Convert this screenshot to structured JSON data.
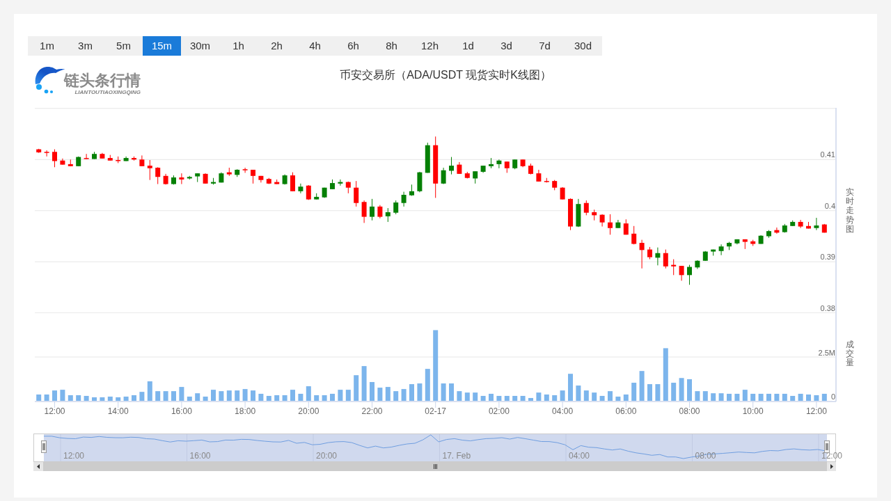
{
  "timeframes": [
    {
      "label": "1m",
      "selected": false
    },
    {
      "label": "3m",
      "selected": false
    },
    {
      "label": "5m",
      "selected": false
    },
    {
      "label": "15m",
      "selected": true
    },
    {
      "label": "30m",
      "selected": false
    },
    {
      "label": "1h",
      "selected": false
    },
    {
      "label": "2h",
      "selected": false
    },
    {
      "label": "4h",
      "selected": false
    },
    {
      "label": "6h",
      "selected": false
    },
    {
      "label": "8h",
      "selected": false
    },
    {
      "label": "12h",
      "selected": false
    },
    {
      "label": "1d",
      "selected": false
    },
    {
      "label": "3d",
      "selected": false
    },
    {
      "label": "7d",
      "selected": false
    },
    {
      "label": "30d",
      "selected": false
    }
  ],
  "logo": {
    "name": "链头条行情",
    "subtitle": "LIANTOUTIAOXINGQING"
  },
  "title": "币安交易所（ADA/USDT 现货实时K线图）",
  "price_chart": {
    "chart_data": {
      "type": "candlestick",
      "ylabel": "实时走势图",
      "grid": true,
      "categories": [
        null,
        null,
        null,
        null,
        null,
        null,
        null,
        null,
        null,
        null,
        null,
        null,
        null,
        null,
        null,
        null,
        null,
        null,
        null,
        null,
        null,
        null,
        null,
        null,
        null,
        null,
        null,
        null,
        null,
        null,
        null,
        null,
        null,
        null,
        null,
        null,
        null,
        null,
        null,
        null,
        null,
        null,
        null,
        null,
        null,
        null,
        null,
        null,
        null,
        null,
        null,
        null,
        null,
        null,
        null,
        null,
        null,
        null,
        null,
        null,
        null,
        null,
        null,
        null,
        null,
        null,
        null,
        null,
        null,
        null,
        null,
        null,
        null,
        null,
        null,
        null,
        null,
        null,
        null,
        null,
        null,
        null,
        null,
        null,
        null,
        null,
        null,
        null,
        null,
        null,
        null,
        null,
        null,
        null,
        null,
        null,
        null,
        null,
        null,
        null
      ],
      "ylim": [
        0.38,
        0.42
      ],
      "yticks": [
        0.41,
        0.4,
        0.39,
        0.38
      ],
      "ohlc": [
        [
          0.412,
          0.4121,
          0.4113,
          0.4114
        ],
        [
          0.4115,
          0.4118,
          0.4106,
          0.4114
        ],
        [
          0.4115,
          0.412,
          0.4085,
          0.4097
        ],
        [
          0.4098,
          0.4102,
          0.409,
          0.409
        ],
        [
          0.4091,
          0.41,
          0.4087,
          0.4087
        ],
        [
          0.4087,
          0.4106,
          0.4087,
          0.4105
        ],
        [
          0.4103,
          0.4111,
          0.4101,
          0.4101
        ],
        [
          0.4101,
          0.4115,
          0.4101,
          0.4111
        ],
        [
          0.4111,
          0.4113,
          0.4102,
          0.4102
        ],
        [
          0.4103,
          0.4109,
          0.4098,
          0.4098
        ],
        [
          0.4099,
          0.4106,
          0.4093,
          0.4097
        ],
        [
          0.4097,
          0.4106,
          0.4097,
          0.4103
        ],
        [
          0.4103,
          0.4106,
          0.4098,
          0.41
        ],
        [
          0.41,
          0.4108,
          0.4087,
          0.4087
        ],
        [
          0.4088,
          0.4099,
          0.406,
          0.4083
        ],
        [
          0.4084,
          0.4085,
          0.4052,
          0.4066
        ],
        [
          0.4068,
          0.4072,
          0.4051,
          0.4052
        ],
        [
          0.4052,
          0.4069,
          0.4051,
          0.4065
        ],
        [
          0.4065,
          0.4073,
          0.4052,
          0.4061
        ],
        [
          0.4063,
          0.4068,
          0.4061,
          0.4066
        ],
        [
          0.4067,
          0.4073,
          0.4056,
          0.4073
        ],
        [
          0.4072,
          0.4073,
          0.4053,
          0.4053
        ],
        [
          0.4053,
          0.4064,
          0.4051,
          0.4056
        ],
        [
          0.4055,
          0.4075,
          0.4055,
          0.4073
        ],
        [
          0.4075,
          0.4084,
          0.4068,
          0.4071
        ],
        [
          0.407,
          0.4081,
          0.4066,
          0.408
        ],
        [
          0.4081,
          0.4084,
          0.4074,
          0.4079
        ],
        [
          0.408,
          0.408,
          0.4053,
          0.4068
        ],
        [
          0.4068,
          0.4068,
          0.4055,
          0.406
        ],
        [
          0.4062,
          0.4064,
          0.4052,
          0.4053
        ],
        [
          0.4056,
          0.4061,
          0.4052,
          0.4052
        ],
        [
          0.4052,
          0.4071,
          0.4051,
          0.4069
        ],
        [
          0.4069,
          0.4075,
          0.4038,
          0.4038
        ],
        [
          0.4038,
          0.4053,
          0.4034,
          0.4047
        ],
        [
          0.4049,
          0.405,
          0.4021,
          0.4022
        ],
        [
          0.4022,
          0.4034,
          0.4022,
          0.4027
        ],
        [
          0.4026,
          0.4045,
          0.4025,
          0.4045
        ],
        [
          0.4042,
          0.4061,
          0.4042,
          0.4054
        ],
        [
          0.4053,
          0.4061,
          0.4049,
          0.4056
        ],
        [
          0.4056,
          0.4057,
          0.4034,
          0.4045
        ],
        [
          0.4045,
          0.4058,
          0.4008,
          0.4015
        ],
        [
          0.4017,
          0.402,
          0.3976,
          0.3988
        ],
        [
          0.3988,
          0.4023,
          0.3981,
          0.4008
        ],
        [
          0.4008,
          0.4011,
          0.3985,
          0.3988
        ],
        [
          0.3989,
          0.4005,
          0.3978,
          0.3997
        ],
        [
          0.3996,
          0.402,
          0.3993,
          0.4016
        ],
        [
          0.4015,
          0.4037,
          0.4008,
          0.4031
        ],
        [
          0.403,
          0.4051,
          0.4029,
          0.4038
        ],
        [
          0.4038,
          0.4076,
          0.4036,
          0.4075
        ],
        [
          0.4074,
          0.4133,
          0.4074,
          0.4128
        ],
        [
          0.4128,
          0.4145,
          0.4025,
          0.4053
        ],
        [
          0.4053,
          0.4084,
          0.4052,
          0.4079
        ],
        [
          0.4078,
          0.4105,
          0.4071,
          0.4088
        ],
        [
          0.409,
          0.4095,
          0.4072,
          0.4072
        ],
        [
          0.4073,
          0.4076,
          0.4063,
          0.4064
        ],
        [
          0.4063,
          0.4077,
          0.4053,
          0.4077
        ],
        [
          0.4076,
          0.4088,
          0.4074,
          0.4088
        ],
        [
          0.4087,
          0.4103,
          0.4083,
          0.4091
        ],
        [
          0.4091,
          0.41,
          0.4083,
          0.4098
        ],
        [
          0.4096,
          0.4096,
          0.4074,
          0.4083
        ],
        [
          0.4083,
          0.41,
          0.4081,
          0.41
        ],
        [
          0.41,
          0.41,
          0.4085,
          0.4087
        ],
        [
          0.4088,
          0.4092,
          0.4071,
          0.4072
        ],
        [
          0.4073,
          0.408,
          0.4057,
          0.4057
        ],
        [
          0.4058,
          0.4064,
          0.4055,
          0.4056
        ],
        [
          0.4058,
          0.406,
          0.404,
          0.4045
        ],
        [
          0.4045,
          0.4046,
          0.4022,
          0.4022
        ],
        [
          0.4023,
          0.4024,
          0.3962,
          0.3969
        ],
        [
          0.3969,
          0.4023,
          0.3968,
          0.4013
        ],
        [
          0.4015,
          0.402,
          0.3991,
          0.3996
        ],
        [
          0.3997,
          0.4002,
          0.3981,
          0.3991
        ],
        [
          0.3992,
          0.3993,
          0.3969,
          0.3977
        ],
        [
          0.3977,
          0.3993,
          0.3953,
          0.3966
        ],
        [
          0.3966,
          0.3982,
          0.3966,
          0.3977
        ],
        [
          0.3975,
          0.3983,
          0.3953,
          0.3953
        ],
        [
          0.3955,
          0.397,
          0.3934,
          0.3935
        ],
        [
          0.3937,
          0.3943,
          0.3887,
          0.3923
        ],
        [
          0.3924,
          0.3929,
          0.3905,
          0.3909
        ],
        [
          0.3908,
          0.3928,
          0.3893,
          0.3917
        ],
        [
          0.3917,
          0.3924,
          0.3887,
          0.3891
        ],
        [
          0.3894,
          0.3905,
          0.3874,
          0.3891
        ],
        [
          0.3892,
          0.3892,
          0.3863,
          0.3874
        ],
        [
          0.3874,
          0.3894,
          0.3855,
          0.389
        ],
        [
          0.3889,
          0.3903,
          0.3886,
          0.3902
        ],
        [
          0.3902,
          0.3921,
          0.3902,
          0.392
        ],
        [
          0.392,
          0.3924,
          0.3912,
          0.3924
        ],
        [
          0.3921,
          0.3934,
          0.3913,
          0.393
        ],
        [
          0.393,
          0.3939,
          0.3923,
          0.3937
        ],
        [
          0.3936,
          0.3944,
          0.3934,
          0.3944
        ],
        [
          0.3944,
          0.3944,
          0.3925,
          0.3939
        ],
        [
          0.394,
          0.3943,
          0.3931,
          0.3935
        ],
        [
          0.3935,
          0.3952,
          0.3935,
          0.3951
        ],
        [
          0.395,
          0.3962,
          0.3947,
          0.396
        ],
        [
          0.3962,
          0.3967,
          0.3955,
          0.3957
        ],
        [
          0.3958,
          0.3974,
          0.3957,
          0.3971
        ],
        [
          0.397,
          0.3981,
          0.397,
          0.3978
        ],
        [
          0.3978,
          0.3982,
          0.3966,
          0.3969
        ],
        [
          0.397,
          0.3978,
          0.3965,
          0.3965
        ],
        [
          0.3966,
          0.3986,
          0.3962,
          0.3971
        ],
        [
          0.3973,
          0.3974,
          0.3957,
          0.3957
        ]
      ]
    }
  },
  "volume_chart": {
    "chart_data": {
      "type": "bar",
      "ylabel": "成交量",
      "grid": true,
      "categories": [
        null,
        null,
        "12:00",
        null,
        null,
        null,
        null,
        null,
        null,
        null,
        "14:00",
        null,
        null,
        null,
        null,
        null,
        null,
        null,
        "16:00",
        null,
        null,
        null,
        null,
        null,
        null,
        null,
        "18:00",
        null,
        null,
        null,
        null,
        null,
        null,
        null,
        "20:00",
        null,
        null,
        null,
        null,
        null,
        null,
        null,
        "22:00",
        null,
        null,
        null,
        null,
        null,
        null,
        null,
        "02-17",
        null,
        null,
        null,
        null,
        null,
        null,
        null,
        "02:00",
        null,
        null,
        null,
        null,
        null,
        null,
        null,
        "04:00",
        null,
        null,
        null,
        null,
        null,
        null,
        null,
        "06:00",
        null,
        null,
        null,
        null,
        null,
        null,
        null,
        "08:00",
        null,
        null,
        null,
        null,
        null,
        null,
        null,
        "10:00",
        null,
        null,
        null,
        null,
        null,
        null,
        null,
        "12:00",
        null
      ],
      "values": [
        0.36,
        0.36,
        0.59,
        0.63,
        0.32,
        0.32,
        0.28,
        0.2,
        0.2,
        0.24,
        0.2,
        0.24,
        0.32,
        0.51,
        1.11,
        0.55,
        0.55,
        0.55,
        0.79,
        0.24,
        0.43,
        0.24,
        0.63,
        0.55,
        0.59,
        0.59,
        0.67,
        0.59,
        0.4,
        0.28,
        0.32,
        0.32,
        0.63,
        0.4,
        0.83,
        0.32,
        0.32,
        0.4,
        0.63,
        0.63,
        1.46,
        1.98,
        1.07,
        0.75,
        0.79,
        0.55,
        0.67,
        0.95,
        0.99,
        1.82,
        4.03,
        0.99,
        0.99,
        0.55,
        0.47,
        0.47,
        0.28,
        0.4,
        0.28,
        0.28,
        0.28,
        0.28,
        0.16,
        0.47,
        0.36,
        0.32,
        0.59,
        1.54,
        0.87,
        0.59,
        0.47,
        0.28,
        0.55,
        0.24,
        0.36,
        1.03,
        1.7,
        0.95,
        0.95,
        3.0,
        1.03,
        1.3,
        1.23,
        0.55,
        0.55,
        0.43,
        0.43,
        0.4,
        0.4,
        0.63,
        0.4,
        0.4,
        0.4,
        0.4,
        0.4,
        0.28,
        0.4,
        0.36,
        0.32,
        0.4
      ],
      "ylim": [
        0,
        5
      ],
      "yticks": [
        {
          "value": 0,
          "label": "0"
        },
        {
          "value": 2.5,
          "label": "2.5M"
        }
      ]
    }
  },
  "navigator": {
    "labels": [
      "12:00",
      "16:00",
      "20:00",
      "17. Feb",
      "04:00",
      "08:00",
      "12:00"
    ]
  }
}
